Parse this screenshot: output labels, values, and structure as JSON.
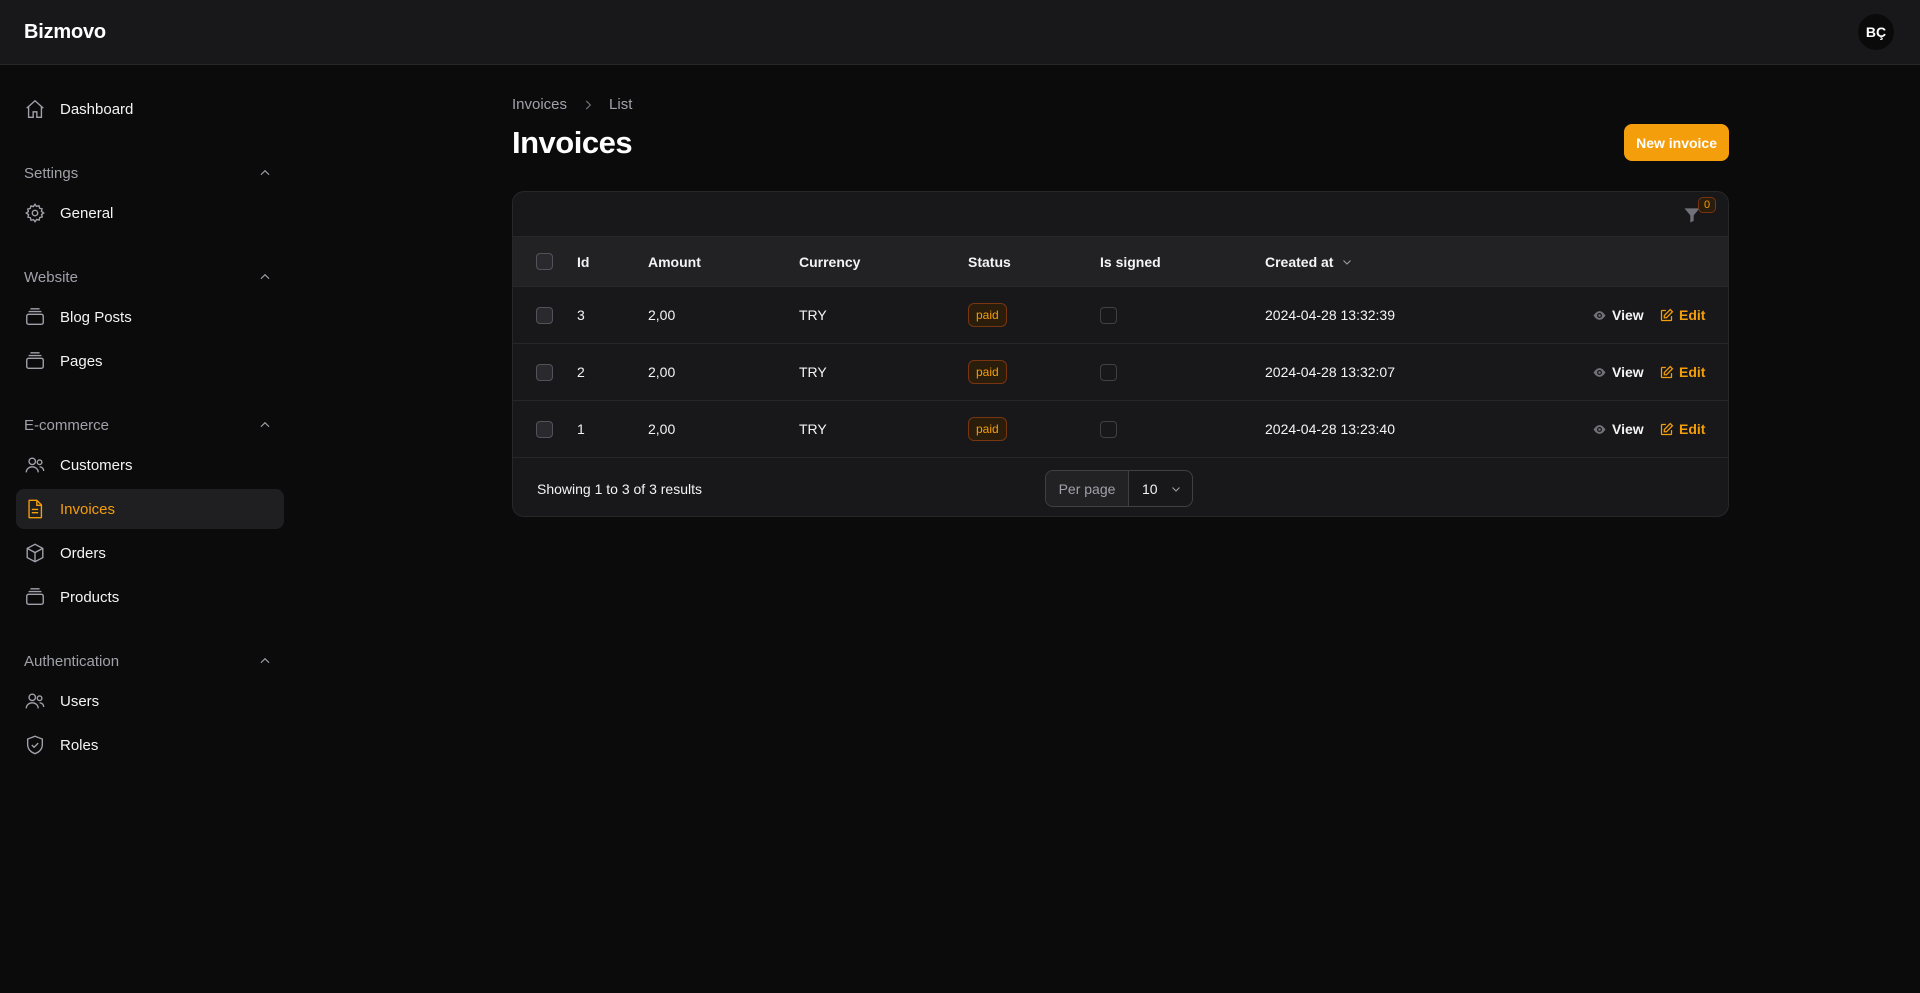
{
  "app": {
    "brand": "Bizmovo",
    "user_initials": "BÇ"
  },
  "sidebar": {
    "dashboard": {
      "label": "Dashboard",
      "icon": "home-icon"
    },
    "groups": [
      {
        "label": "Settings",
        "items": [
          {
            "label": "General",
            "icon": "gear-icon"
          }
        ]
      },
      {
        "label": "Website",
        "items": [
          {
            "label": "Blog Posts",
            "icon": "stack-icon"
          },
          {
            "label": "Pages",
            "icon": "stack-icon"
          }
        ]
      },
      {
        "label": "E-commerce",
        "items": [
          {
            "label": "Customers",
            "icon": "users-icon"
          },
          {
            "label": "Invoices",
            "icon": "document-icon",
            "active": true
          },
          {
            "label": "Orders",
            "icon": "cube-icon"
          },
          {
            "label": "Products",
            "icon": "stack-icon"
          }
        ]
      },
      {
        "label": "Authentication",
        "items": [
          {
            "label": "Users",
            "icon": "users-icon"
          },
          {
            "label": "Roles",
            "icon": "shield-icon"
          }
        ]
      }
    ]
  },
  "breadcrumb": {
    "parent": "Invoices",
    "current": "List"
  },
  "page": {
    "title": "Invoices",
    "new_button": "New invoice"
  },
  "table": {
    "filter_count": "0",
    "columns": {
      "id": "Id",
      "amount": "Amount",
      "currency": "Currency",
      "status": "Status",
      "is_signed": "Is signed",
      "created_at": "Created at"
    },
    "rows": [
      {
        "id": "3",
        "amount": "2,00",
        "currency": "TRY",
        "status": "paid",
        "created_at": "2024-04-28 13:32:39"
      },
      {
        "id": "2",
        "amount": "2,00",
        "currency": "TRY",
        "status": "paid",
        "created_at": "2024-04-28 13:32:07"
      },
      {
        "id": "1",
        "amount": "2,00",
        "currency": "TRY",
        "status": "paid",
        "created_at": "2024-04-28 13:23:40"
      }
    ],
    "actions": {
      "view": "View",
      "edit": "Edit"
    },
    "footer": {
      "summary": "Showing 1 to 3 of 3 results",
      "per_page_label": "Per page",
      "per_page_value": "10"
    }
  },
  "colors": {
    "accent": "#f59e0b",
    "background": "#0b0b0c",
    "surface": "#18181b"
  }
}
